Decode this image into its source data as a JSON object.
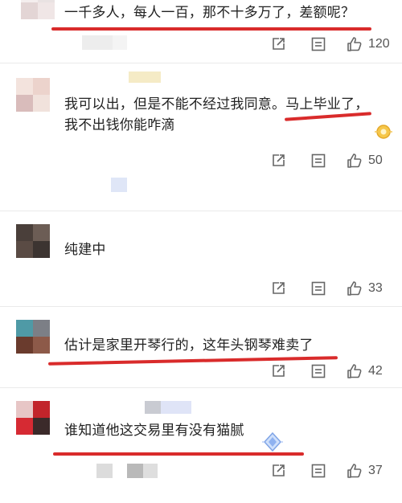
{
  "comments": [
    {
      "text_lines": [
        "一千多人，每人一百，那不十多万了，差额呢？"
      ],
      "likes": "120"
    },
    {
      "text_lines": [
        "我可以出，但是不能不经过我同意。马上毕业了，",
        "我不出钱你能咋滴"
      ],
      "likes": "50"
    },
    {
      "text_lines": [
        "纯建中"
      ],
      "likes": "33"
    },
    {
      "text_lines": [
        "估计是家里开琴行的，这年头钢琴难卖了"
      ],
      "likes": "42"
    },
    {
      "text_lines": [
        "谁知道他这交易里有没有猫腻"
      ],
      "likes": "37"
    }
  ],
  "icons": {
    "share": "share-icon",
    "comment": "comment-icon",
    "like": "thumbs-up-icon"
  },
  "colors": {
    "underline": "#d92b2b",
    "icon": "#666666"
  }
}
